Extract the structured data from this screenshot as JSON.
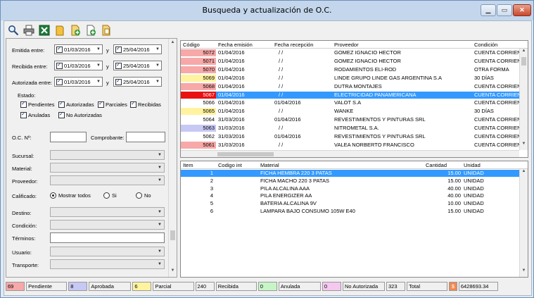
{
  "window": {
    "title": "Busqueda y actualización de O.C."
  },
  "toolbar": {
    "buttons": [
      "search-icon",
      "print-icon",
      "excel-icon",
      "folder-icon",
      "add-doc-icon",
      "new-doc-icon",
      "edit-doc-icon"
    ]
  },
  "filters": {
    "emitida_label": "Emitida entre:",
    "recibida_label": "Recibida entre:",
    "autorizada_label": "Autorizada entre:",
    "y": "y",
    "emitida_from": "01/03/2016",
    "emitida_to": "25/04/2016",
    "recibida_from": "01/03/2016",
    "recibida_to": "25/04/2016",
    "autorizada_from": "01/03/2016",
    "autorizada_to": "25/04/2016",
    "estado_label": "Estado:",
    "estados": [
      "Pendientes",
      "Autorizadas",
      "Parciales",
      "Recibidas",
      "Anuladas",
      "No Autorizadas"
    ],
    "oc_label": "O.C. Nº:",
    "comprobante_label": "Comprobante:",
    "sucursal_label": "Sucursal:",
    "material_label": "Material:",
    "proveedor_label": "Proveedor:",
    "calificado_label": "Calificado:",
    "radio_todos": "Mostrar todos",
    "radio_si": "Si",
    "radio_no": "No",
    "destino_label": "Destino:",
    "condicion_label": "Condición:",
    "terminos_label": "Términos:",
    "usuario_label": "Usuario:",
    "transporte_label": "Transporte:"
  },
  "orders": {
    "headers": [
      "Código",
      "Fecha emisión",
      "Fecha recepción",
      "Proveedor",
      "Condición"
    ],
    "rows": [
      {
        "code": "5072",
        "emision": "01/04/2016",
        "recepcion": "/ /",
        "proveedor": "GOMEZ IGNACIO HECTOR",
        "condicion": "CUENTA CORRIEN",
        "color": "#f7a8a8"
      },
      {
        "code": "5071",
        "emision": "01/04/2016",
        "recepcion": "/ /",
        "proveedor": "GOMEZ IGNACIO HECTOR",
        "condicion": "CUENTA CORRIEN",
        "color": "#f7a8a8"
      },
      {
        "code": "5070",
        "emision": "01/04/2016",
        "recepcion": "/ /",
        "proveedor": "RODAMIENTOS ELI-ROD",
        "condicion": "OTRA FORMA",
        "color": "#f7a8a8"
      },
      {
        "code": "5069",
        "emision": "01/04/2016",
        "recepcion": "/ /",
        "proveedor": "LINDE GRUPO LINDE GAS ARGENTINA S.A",
        "condicion": "30 DÍAS",
        "color": "#fff3a0"
      },
      {
        "code": "5068",
        "emision": "01/04/2016",
        "recepcion": "/ /",
        "proveedor": "DUTRA MONTAJES",
        "condicion": "CUENTA CORRIEN",
        "color": "#f7a8a8"
      },
      {
        "code": "5067",
        "emision": "01/04/2016",
        "recepcion": "/ /",
        "proveedor": "ELECTRICIDAD  PANAMERICANA",
        "condicion": "CUENTA CORRIEN",
        "color": "#e81010",
        "selected": true
      },
      {
        "code": "5066",
        "emision": "01/04/2016",
        "recepcion": "01/04/2016",
        "proveedor": "VALOT S.A",
        "condicion": "CUENTA CORRIEN",
        "color": "#ffffff"
      },
      {
        "code": "5065",
        "emision": "01/04/2016",
        "recepcion": "/ /",
        "proveedor": "WANKE",
        "condicion": "30 DÍAS",
        "color": "#fff3a0"
      },
      {
        "code": "5064",
        "emision": "31/03/2016",
        "recepcion": "01/04/2016",
        "proveedor": "REVESTIMIENTOS Y PINTURAS SRL",
        "condicion": "CUENTA CORRIEN",
        "color": "#ffffff"
      },
      {
        "code": "5063",
        "emision": "31/03/2016",
        "recepcion": "/ /",
        "proveedor": "NITROMETAL S.A.",
        "condicion": "CUENTA CORRIEN",
        "color": "#c8c8f5"
      },
      {
        "code": "5062",
        "emision": "31/03/2016",
        "recepcion": "01/04/2016",
        "proveedor": "REVESTIMIENTOS Y PINTURAS SRL",
        "condicion": "CUENTA CORRIEN",
        "color": "#ffffff"
      },
      {
        "code": "5061",
        "emision": "31/03/2016",
        "recepcion": "/ /",
        "proveedor": "VALEA NORBERTO FRANCISCO",
        "condicion": "CUENTA CORRIEN",
        "color": "#f7a8a8"
      }
    ]
  },
  "items": {
    "headers": [
      "Item",
      "Codigo int",
      "Material",
      "Cantidad",
      "Unidad"
    ],
    "rows": [
      {
        "item": "1",
        "codigo": "",
        "material": "FICHA  HEMBRA  220  3  PATAS",
        "cantidad": "15.00",
        "unidad": "UNIDAD",
        "selected": true
      },
      {
        "item": "2",
        "codigo": "",
        "material": "FICHA  MACHO  220  3  PATAS",
        "cantidad": "15.00",
        "unidad": "UNIDAD"
      },
      {
        "item": "3",
        "codigo": "",
        "material": "PILA ALCALINA  AAA",
        "cantidad": "40.00",
        "unidad": "UNIDAD"
      },
      {
        "item": "4",
        "codigo": "",
        "material": "PILA ENERGIZER AA",
        "cantidad": "40.00",
        "unidad": "UNIDAD"
      },
      {
        "item": "5",
        "codigo": "",
        "material": "BATERIA ALCALINA 9V",
        "cantidad": "10.00",
        "unidad": "UNIDAD"
      },
      {
        "item": "6",
        "codigo": "",
        "material": "LAMPARA BAJO CONSUMO 105W  E40",
        "cantidad": "15.00",
        "unidad": "UNIDAD"
      }
    ]
  },
  "status": [
    {
      "count": "69",
      "color": "#f7a8a8",
      "label": "Pendiente"
    },
    {
      "count": "8",
      "color": "#c8c8f5",
      "label": "Aprobada"
    },
    {
      "count": "6",
      "color": "#fff3a0",
      "label": "Parcial"
    },
    {
      "count": "240",
      "color": "#f0f0f0",
      "label": "Recibida"
    },
    {
      "count": "0",
      "color": "#c8f5c8",
      "label": "Anulada"
    },
    {
      "count": "0",
      "color": "#f5c8f0",
      "label": "No Autorizada"
    },
    {
      "count": "323",
      "color": "#f0f0f0",
      "label": "Total"
    }
  ],
  "total_amount": "6428693.34"
}
